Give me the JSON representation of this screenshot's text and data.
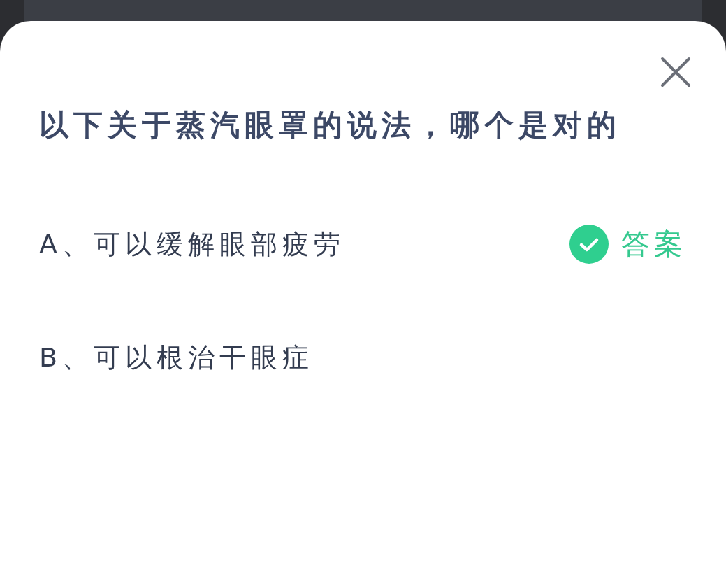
{
  "dialog": {
    "question": "以下关于蒸汽眼罩的说法，哪个是对的",
    "options": [
      {
        "text": "A、可以缓解眼部疲劳",
        "correct": true
      },
      {
        "text": "B、可以根治干眼症",
        "correct": false
      }
    ],
    "answer_label": "答案"
  }
}
